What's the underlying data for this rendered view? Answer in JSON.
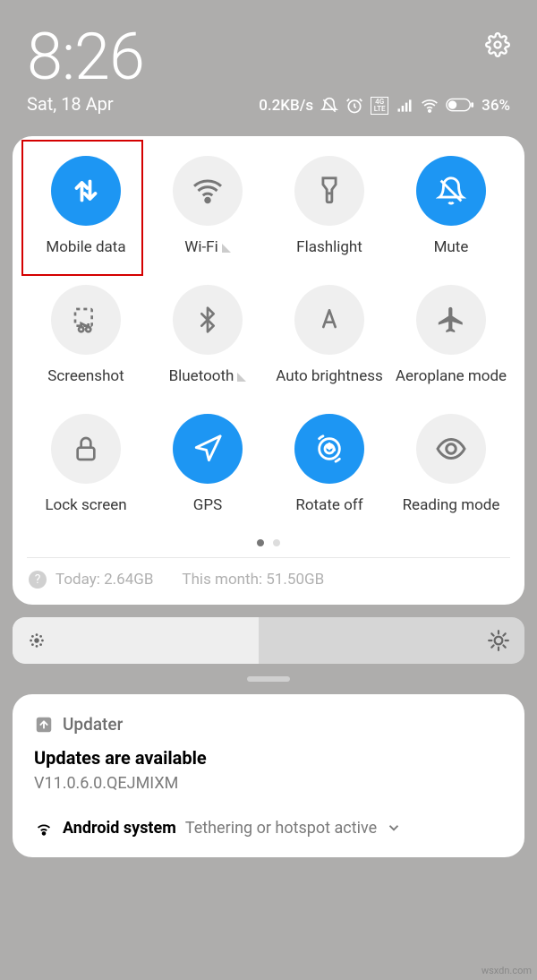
{
  "status": {
    "time": "8:26",
    "date": "Sat, 18 Apr",
    "net_speed": "0.2KB/s",
    "battery": "36%",
    "lte": "4G LTE"
  },
  "toggles": [
    {
      "id": "mobile-data",
      "label": "Mobile data",
      "active": true,
      "expandable": false
    },
    {
      "id": "wifi",
      "label": "Wi-Fi",
      "active": false,
      "expandable": true
    },
    {
      "id": "flashlight",
      "label": "Flashlight",
      "active": false,
      "expandable": false
    },
    {
      "id": "mute",
      "label": "Mute",
      "active": true,
      "expandable": false
    },
    {
      "id": "screenshot",
      "label": "Screenshot",
      "active": false,
      "expandable": false
    },
    {
      "id": "bluetooth",
      "label": "Bluetooth",
      "active": false,
      "expandable": true
    },
    {
      "id": "auto-brightness",
      "label": "Auto brightness",
      "active": false,
      "expandable": false
    },
    {
      "id": "aeroplane-mode",
      "label": "Aeroplane mode",
      "active": false,
      "expandable": false
    },
    {
      "id": "lock-screen",
      "label": "Lock screen",
      "active": false,
      "expandable": false
    },
    {
      "id": "gps",
      "label": "GPS",
      "active": true,
      "expandable": false
    },
    {
      "id": "rotate-off",
      "label": "Rotate off",
      "active": true,
      "expandable": false
    },
    {
      "id": "reading-mode",
      "label": "Reading mode",
      "active": false,
      "expandable": false
    }
  ],
  "data_usage": {
    "today": "Today: 2.64GB",
    "month": "This month: 51.50GB"
  },
  "notifications": {
    "updater": {
      "app": "Updater",
      "title": "Updates are available",
      "subtitle": "V11.0.6.0.QEJMIXM"
    },
    "system": {
      "app": "Android system",
      "text": "Tethering or hotspot active"
    }
  },
  "watermark": "wsxdn.com"
}
